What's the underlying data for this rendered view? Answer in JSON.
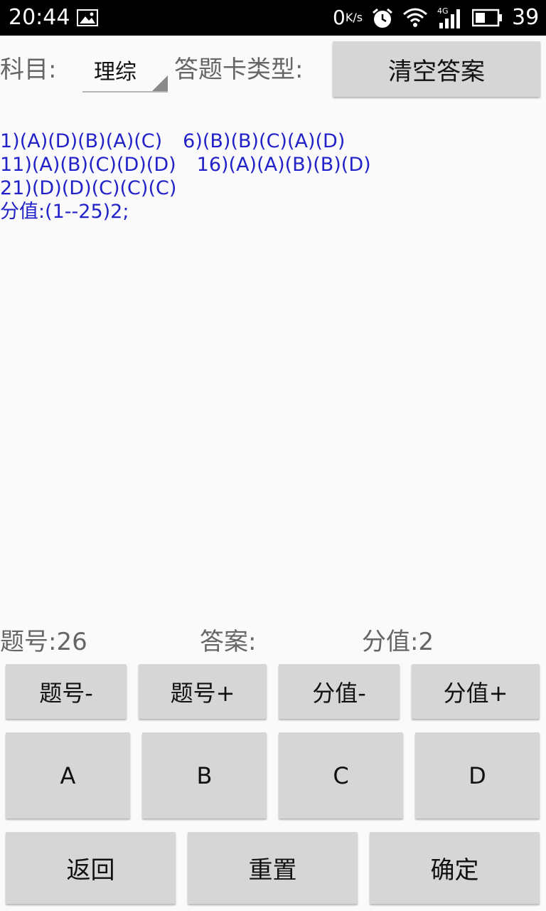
{
  "status_bar": {
    "time": "20:44",
    "net_speed": "0",
    "net_speed_unit": "K/s",
    "network_type": "4G",
    "battery": "39",
    "icons": [
      "image-icon",
      "alarm-icon",
      "wifi-icon",
      "signal-icon",
      "battery-icon"
    ]
  },
  "header": {
    "subject_label": "科目:",
    "subject_value": "理综",
    "card_type_label": "答题卡类型:",
    "clear_button": "清空答案"
  },
  "answers": {
    "rows": [
      [
        "1)(A)(D)(B)(A)(C)",
        "6)(B)(B)(C)(A)(D)"
      ],
      [
        "11)(A)(B)(C)(D)(D)",
        "16)(A)(A)(B)(B)(D)"
      ],
      [
        "21)(D)(D)(C)(C)(C)"
      ]
    ],
    "score_line": "分值:(1--25)2;"
  },
  "info": {
    "question_label": "题号:",
    "question_number": "26",
    "answer_label": "答案:",
    "answer_value": "",
    "score_label": "分值:",
    "score_value": "2"
  },
  "controls": {
    "question_minus": "题号-",
    "question_plus": "题号+",
    "score_minus": "分值-",
    "score_plus": "分值+",
    "options": [
      "A",
      "B",
      "C",
      "D"
    ],
    "back": "返回",
    "reset": "重置",
    "confirm": "确定"
  },
  "colors": {
    "answer_text": "#2222c8",
    "button_bg": "#d6d6d6",
    "background": "#fafafa"
  }
}
